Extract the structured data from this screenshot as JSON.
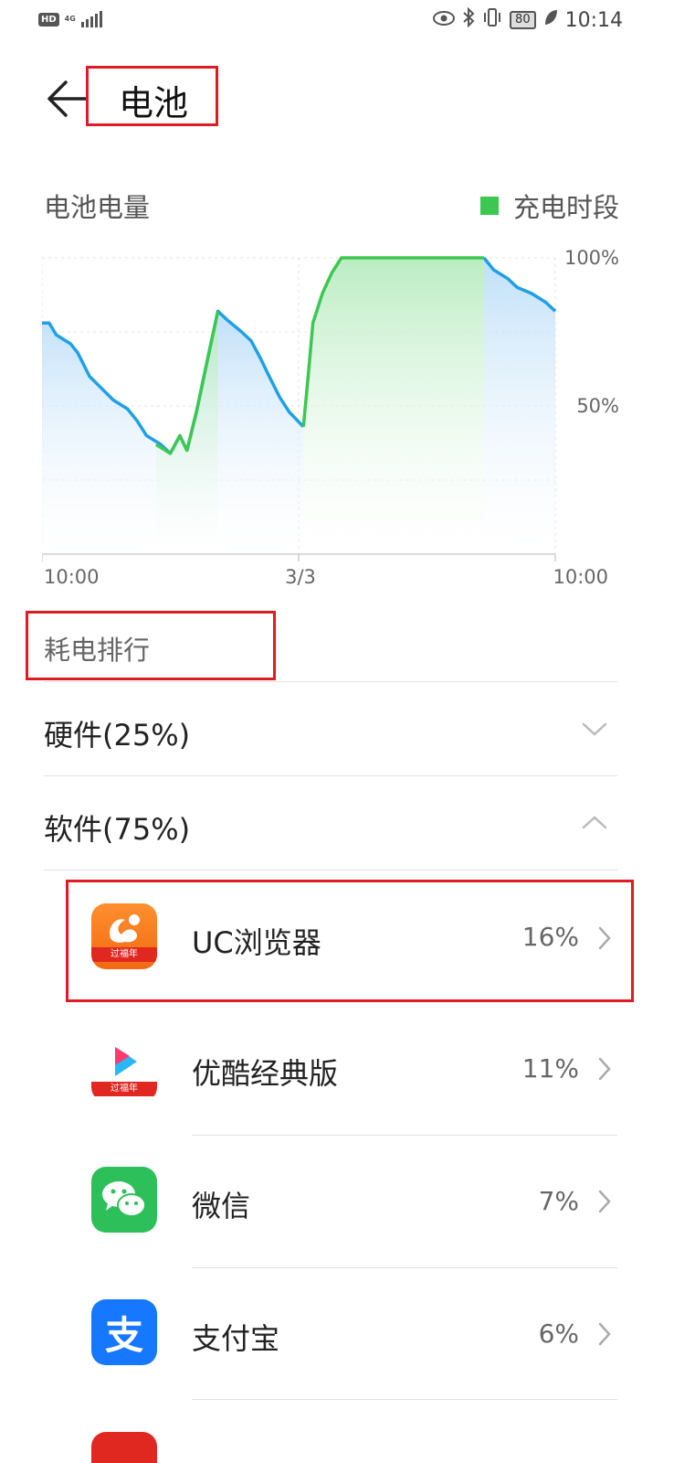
{
  "status_bar": {
    "hd_label": "HD",
    "network_label": "4G",
    "battery_level": "80",
    "time": "10:14"
  },
  "header": {
    "title": "电池",
    "back_icon": "arrow-left-icon"
  },
  "battery_section": {
    "title": "电池电量",
    "legend_label": "充电时段",
    "legend_color": "#3cc850"
  },
  "chart_data": {
    "type": "area",
    "series": [
      {
        "values": [
          [
            0,
            78
          ],
          [
            3,
            78
          ],
          [
            6,
            74
          ],
          [
            12,
            71
          ],
          [
            15,
            68
          ],
          [
            20,
            60
          ],
          [
            25,
            56
          ],
          [
            30,
            52
          ],
          [
            36,
            49
          ],
          [
            40,
            45
          ],
          [
            44,
            40
          ],
          [
            50,
            37
          ],
          [
            54,
            34
          ],
          [
            58,
            40
          ],
          [
            61,
            35
          ]
        ]
      },
      {
        "values": [
          [
            61,
            35
          ],
          [
            65,
            48
          ],
          [
            70,
            67
          ],
          [
            74,
            82
          ],
          [
            78,
            79
          ],
          [
            84,
            75
          ],
          [
            88,
            72
          ],
          [
            92,
            66
          ],
          [
            95,
            61
          ],
          [
            100,
            53
          ],
          [
            104,
            48
          ],
          [
            110,
            43
          ]
        ]
      }
    ],
    "charging_series": [
      [
        [
          48,
          37
        ],
        [
          54,
          34
        ],
        [
          58,
          40
        ],
        [
          61,
          35
        ],
        [
          65,
          48
        ],
        [
          70,
          67
        ],
        [
          74,
          82
        ]
      ],
      [
        [
          110,
          43
        ],
        [
          112,
          60
        ],
        [
          114,
          78
        ],
        [
          118,
          88
        ],
        [
          122,
          95
        ],
        [
          126,
          100
        ],
        [
          140,
          100
        ],
        [
          150,
          100
        ],
        [
          160,
          100
        ],
        [
          170,
          100
        ],
        [
          180,
          100
        ],
        [
          186,
          100
        ]
      ]
    ],
    "after_series": [
      [
        186,
        100
      ],
      [
        190,
        96
      ],
      [
        196,
        93
      ],
      [
        200,
        90
      ],
      [
        206,
        88
      ],
      [
        212,
        85
      ],
      [
        216,
        82
      ]
    ],
    "x_range": [
      0,
      216
    ],
    "x_ticks": [
      "10:00",
      "3/3",
      "10:00"
    ],
    "y_range": [
      0,
      100
    ],
    "y_ticks": [
      "100%",
      "50%"
    ],
    "colors": {
      "discharge": "#1ea0e6",
      "charge": "#3cc850"
    }
  },
  "ranking": {
    "title": "耗电排行",
    "hardware_label": "硬件(25%)",
    "software_label": "软件(75%)",
    "apps": [
      {
        "name": "UC浏览器",
        "percent": "16%",
        "icon": "uc-browser-icon",
        "badge": "过福年"
      },
      {
        "name": "优酷经典版",
        "percent": "11%",
        "icon": "youku-icon",
        "badge": "过福年"
      },
      {
        "name": "微信",
        "percent": "7%",
        "icon": "wechat-icon"
      },
      {
        "name": "支付宝",
        "percent": "6%",
        "icon": "alipay-icon",
        "glyph": "支"
      }
    ]
  }
}
